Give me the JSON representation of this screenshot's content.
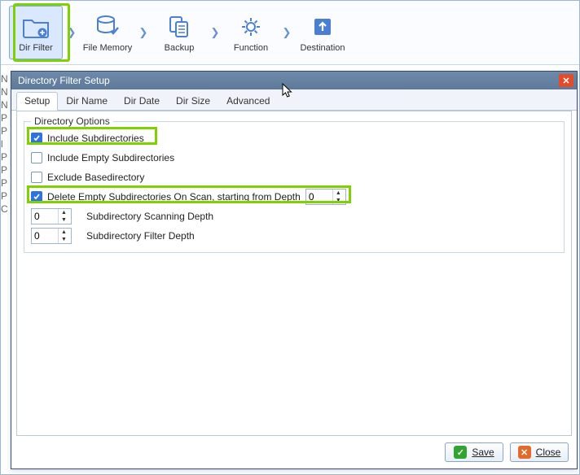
{
  "toolbar": {
    "items": [
      {
        "label": "Dir Filter"
      },
      {
        "label": "File Memory"
      },
      {
        "label": "Backup"
      },
      {
        "label": "Function"
      },
      {
        "label": "Destination"
      }
    ]
  },
  "dialog": {
    "title": "Directory Filter Setup",
    "tabs": [
      "Setup",
      "Dir Name",
      "Dir Date",
      "Dir Size",
      "Advanced"
    ],
    "group_title": "Directory Options",
    "include_sub": {
      "label": "Include Subdirectories",
      "checked": true
    },
    "include_empty": {
      "label": "Include Empty Subdirectories",
      "checked": false
    },
    "exclude_base": {
      "label": "Exclude Basedirectory",
      "checked": false
    },
    "delete_empty": {
      "label": "Delete Empty Subdirectories On Scan, starting from Depth",
      "checked": true,
      "value": "0"
    },
    "scan_depth": {
      "label": "Subdirectory Scanning Depth",
      "value": "0"
    },
    "filter_depth": {
      "label": "Subdirectory Filter Depth",
      "value": "0"
    },
    "save": "Save",
    "close": "Close"
  },
  "bgtext": [
    "N",
    "N",
    "N",
    " ",
    "P",
    "P",
    "l",
    "P",
    "P",
    "P",
    "P",
    "C"
  ]
}
